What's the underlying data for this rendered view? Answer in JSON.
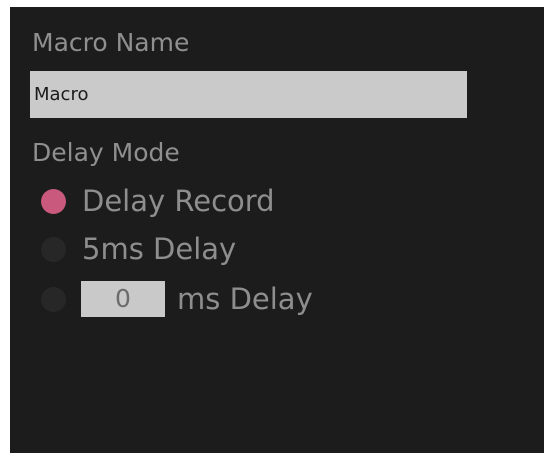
{
  "macro_name": {
    "label": "Macro Name",
    "value": "Macro"
  },
  "delay_mode": {
    "label": "Delay Mode",
    "options": [
      {
        "label": "Delay Record",
        "selected": true
      },
      {
        "label": "5ms Delay",
        "selected": false
      },
      {
        "label": "ms Delay",
        "selected": false,
        "value": "0"
      }
    ]
  },
  "colors": {
    "panel_background": "#1c1c1c",
    "selected_radio": "#c95a7d",
    "unselected_radio": "#272727",
    "input_background": "#cacaca"
  }
}
